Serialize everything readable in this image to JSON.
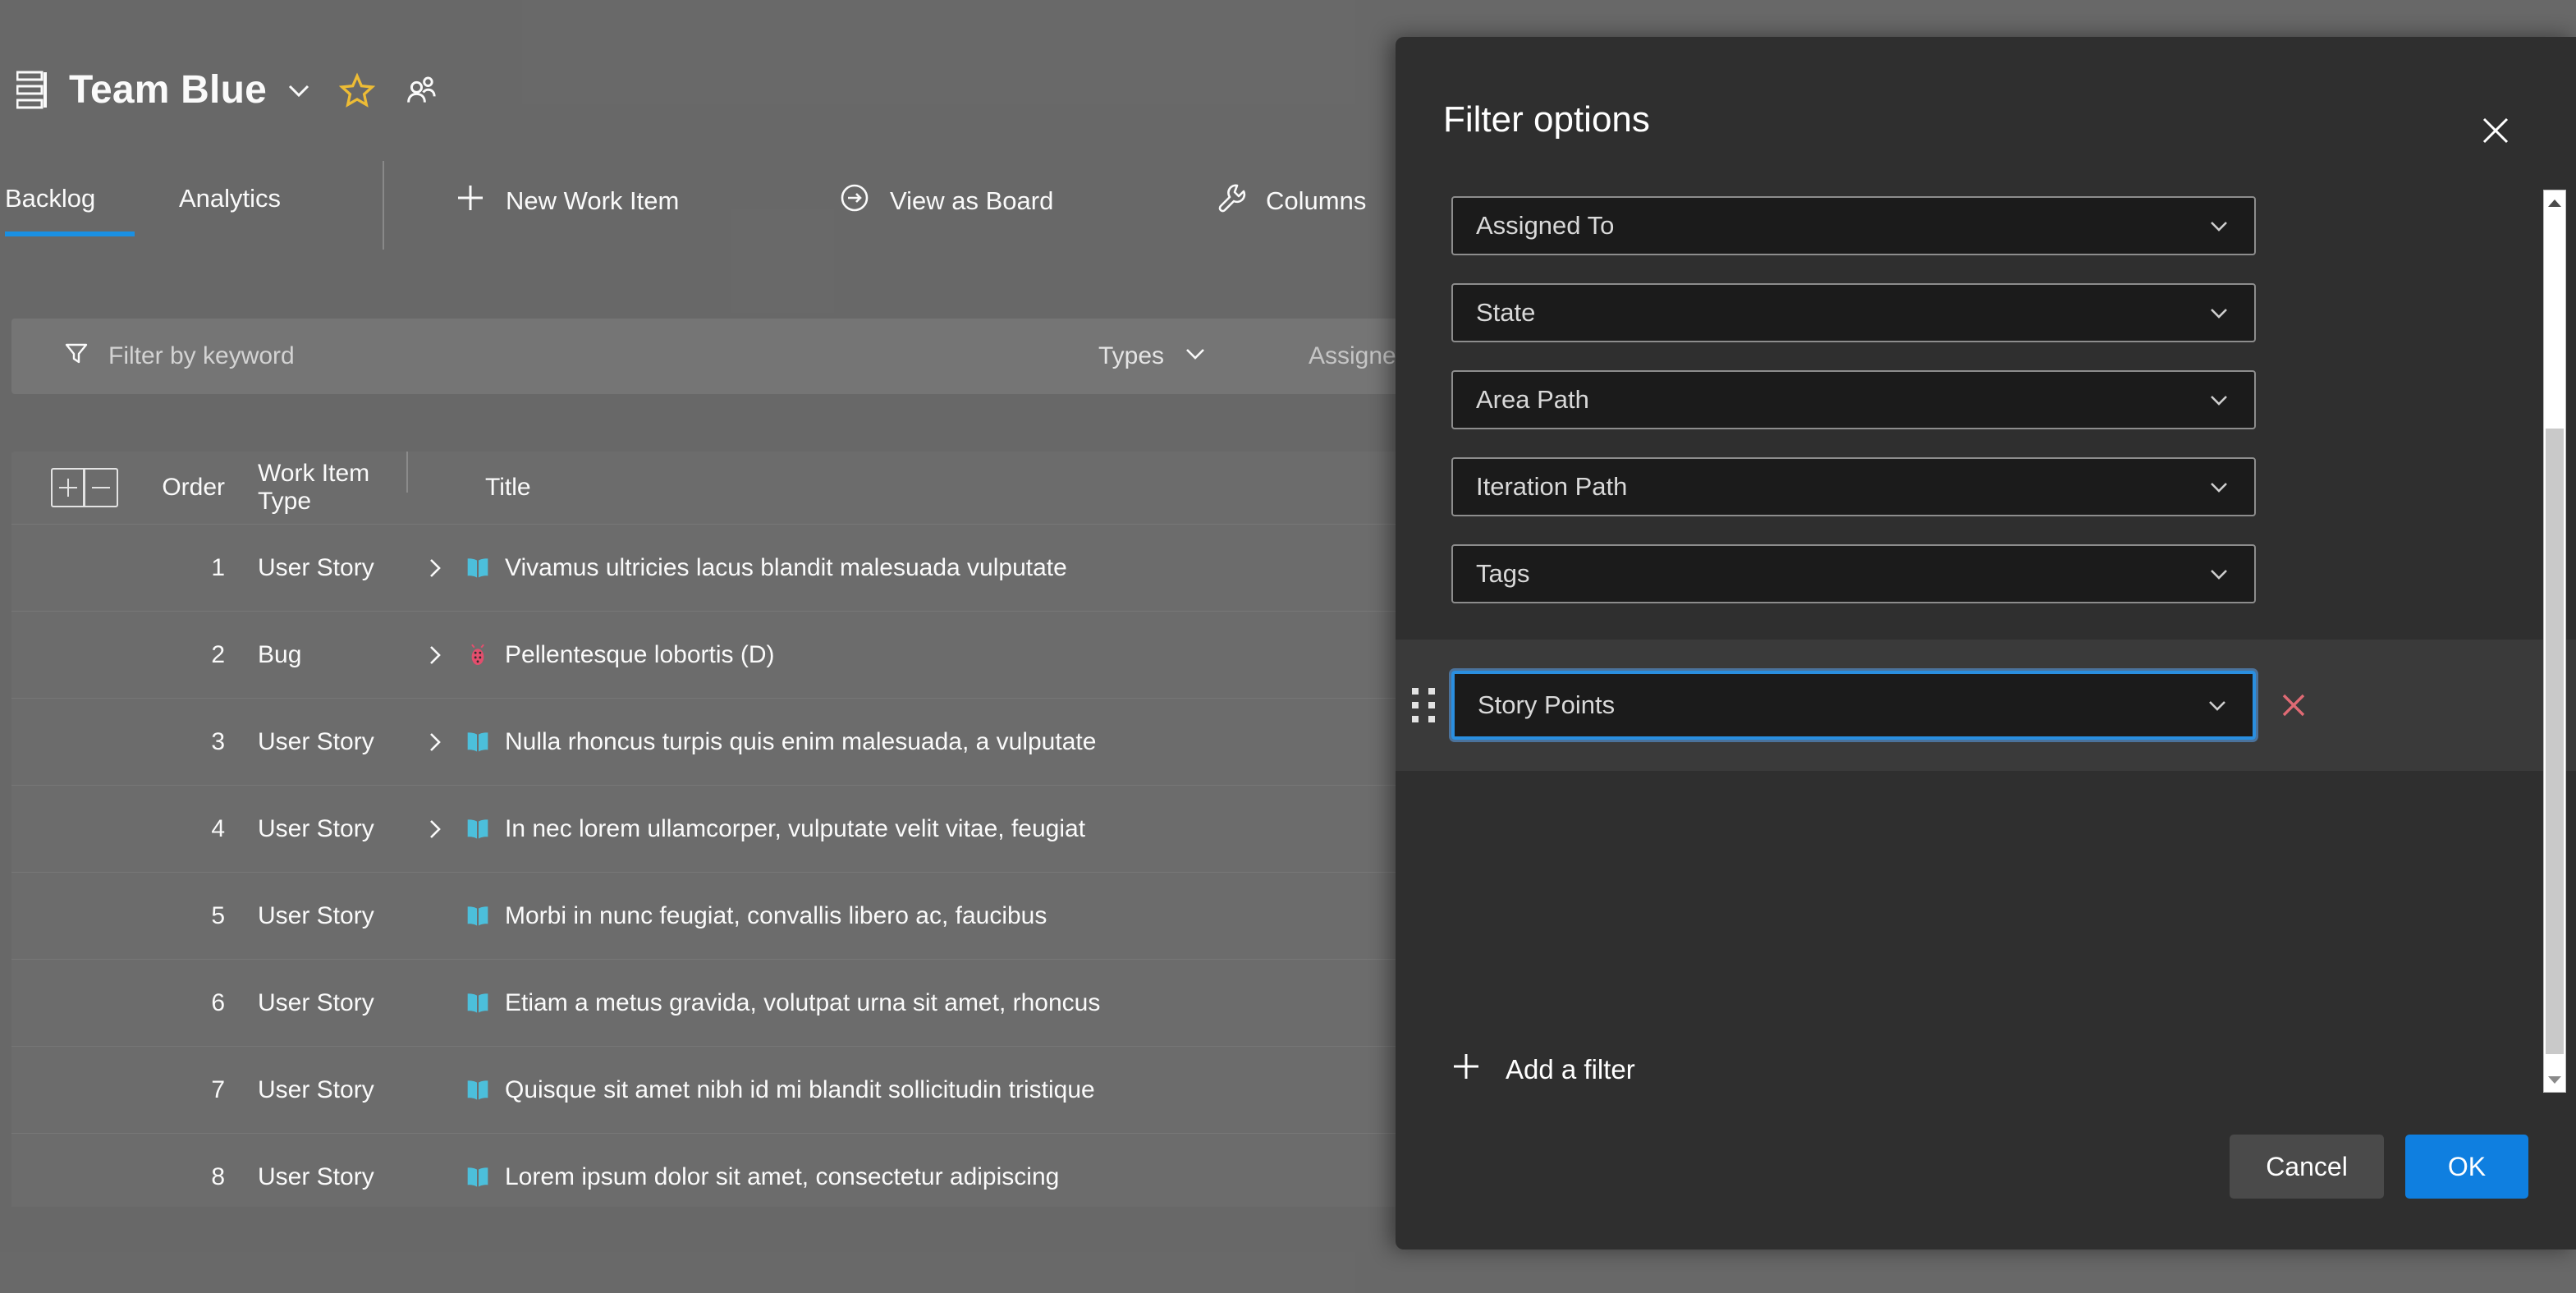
{
  "colors": {
    "accent": "#1b93e8",
    "primary_button": "#0f7fe0",
    "focus_ring": "#2a8fe0",
    "delete_x": "#e06a74",
    "star": "#f2c037",
    "user_story_icon": "#4ec3e0",
    "bug_icon": "#e85070",
    "page_bg": "#6b6b6b",
    "dialog_bg": "#2f2f2f"
  },
  "header": {
    "team_name": "Team Blue",
    "backlog_glyph": "backlog-levels-icon",
    "chevron": "chevron-down-icon",
    "favorite": "star-icon",
    "team_members": "people-icon"
  },
  "tabs": [
    {
      "label": "Backlog",
      "selected": true
    },
    {
      "label": "Analytics",
      "selected": false
    }
  ],
  "commands": [
    {
      "label": "New Work Item",
      "icon": "plus-icon"
    },
    {
      "label": "View as Board",
      "icon": "arrow-right-circle-icon"
    },
    {
      "label": "Columns",
      "icon": "wrench-icon"
    }
  ],
  "filter_bar": {
    "keyword_placeholder": "Filter by keyword",
    "keyword_value": "",
    "filter_icon": "funnel-icon",
    "pills": [
      {
        "label": "Types",
        "icon": "chevron-down-icon"
      },
      {
        "label": "Assigned To",
        "icon": "chevron-down-icon"
      }
    ]
  },
  "table": {
    "expand_all_icon": "expand-all-icon",
    "collapse_all_icon": "collapse-all-icon",
    "columns": [
      "Order",
      "Work Item Type",
      "Title"
    ],
    "rows": [
      {
        "order": "1",
        "type": "User Story",
        "icon": "user-story-icon",
        "expandable": true,
        "title": "Vivamus ultricies lacus blandit malesuada vulputate"
      },
      {
        "order": "2",
        "type": "Bug",
        "icon": "bug-icon",
        "expandable": true,
        "title": "Pellentesque lobortis (D)"
      },
      {
        "order": "3",
        "type": "User Story",
        "icon": "user-story-icon",
        "expandable": true,
        "title": "Nulla rhoncus turpis quis enim malesuada, a vulputate"
      },
      {
        "order": "4",
        "type": "User Story",
        "icon": "user-story-icon",
        "expandable": true,
        "title": "In nec lorem ullamcorper, vulputate velit vitae, feugiat"
      },
      {
        "order": "5",
        "type": "User Story",
        "icon": "user-story-icon",
        "expandable": false,
        "title": "Morbi in nunc feugiat, convallis libero ac, faucibus"
      },
      {
        "order": "6",
        "type": "User Story",
        "icon": "user-story-icon",
        "expandable": false,
        "title": "Etiam a metus gravida, volutpat urna sit amet, rhoncus"
      },
      {
        "order": "7",
        "type": "User Story",
        "icon": "user-story-icon",
        "expandable": false,
        "title": "Quisque sit amet nibh id mi blandit sollicitudin tristique"
      },
      {
        "order": "8",
        "type": "User Story",
        "icon": "user-story-icon",
        "expandable": false,
        "title": "Lorem ipsum dolor sit amet, consectetur adipiscing"
      }
    ]
  },
  "dialog": {
    "title": "Filter options",
    "close_icon": "close-icon",
    "filters": [
      {
        "value": "Assigned To",
        "chevron": "chevron-down-icon",
        "active": false
      },
      {
        "value": "State",
        "chevron": "chevron-down-icon",
        "active": false
      },
      {
        "value": "Area Path",
        "chevron": "chevron-down-icon",
        "active": false
      },
      {
        "value": "Iteration Path",
        "chevron": "chevron-down-icon",
        "active": false
      },
      {
        "value": "Tags",
        "chevron": "chevron-down-icon",
        "active": false
      },
      {
        "value": "Story Points",
        "chevron": "chevron-down-icon",
        "active": true
      }
    ],
    "remove_icon": "close-x-icon",
    "drag_handle_icon": "drag-handle-icon",
    "add_filter": {
      "label": "Add a filter",
      "icon": "plus-icon"
    },
    "buttons": {
      "cancel": "Cancel",
      "ok": "OK"
    },
    "scrollbar": {
      "up_icon": "scroll-up-arrow-icon",
      "down_icon": "scroll-down-arrow-icon"
    }
  }
}
